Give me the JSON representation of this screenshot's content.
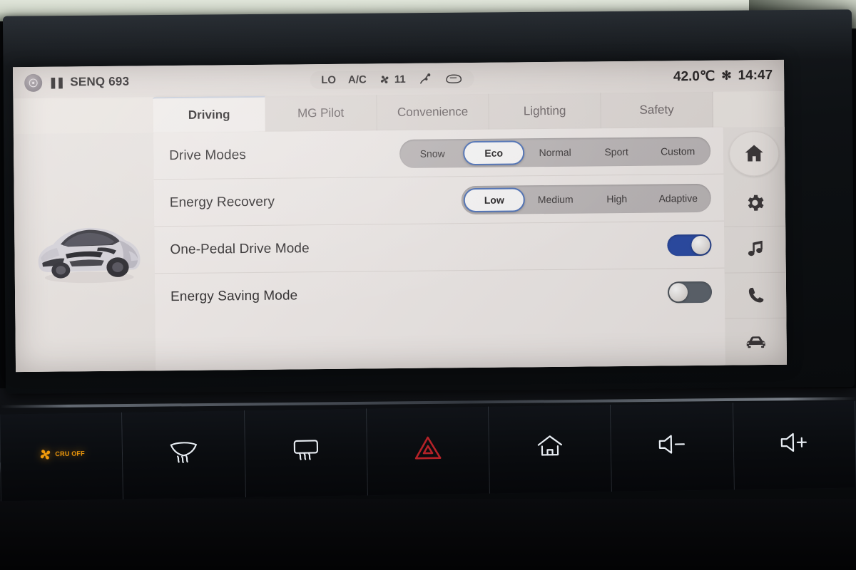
{
  "status_bar": {
    "media_icon": "media-source-icon",
    "playback_glyph": "❚❚",
    "track_title": "SENQ 693",
    "climate": {
      "temp_mode": "LO",
      "ac": "A/C",
      "fan_icon": "fan-icon",
      "fan_speed": "11",
      "airflow_icon": "airflow-direction-icon",
      "defrost_icon": "rear-defrost-icon"
    },
    "outside_temp": "42.0℃",
    "bluetooth_glyph": "✻",
    "clock": "14:47"
  },
  "tabs": [
    {
      "label": "Driving",
      "active": true
    },
    {
      "label": "MG Pilot",
      "active": false
    },
    {
      "label": "Convenience",
      "active": false
    },
    {
      "label": "Lighting",
      "active": false
    },
    {
      "label": "Safety",
      "active": false
    }
  ],
  "vehicle_image": {
    "alt": "MG electric hatchback front three-quarter view",
    "body_color": "#d9d6dc"
  },
  "settings": [
    {
      "label": "Drive Modes",
      "type": "segmented",
      "options": [
        "Snow",
        "Eco",
        "Normal",
        "Sport",
        "Custom"
      ],
      "selected": "Eco"
    },
    {
      "label": "Energy Recovery",
      "type": "segmented",
      "options": [
        "Low",
        "Medium",
        "High",
        "Adaptive"
      ],
      "selected": "Low"
    },
    {
      "label": "One-Pedal Drive Mode",
      "type": "toggle",
      "value": "on"
    },
    {
      "label": "Energy Saving Mode",
      "type": "toggle",
      "value": "off"
    }
  ],
  "dock": [
    {
      "name": "home",
      "icon": "home-icon"
    },
    {
      "name": "settings",
      "icon": "gear-icon"
    },
    {
      "name": "media",
      "icon": "music-note-icon"
    },
    {
      "name": "phone",
      "icon": "phone-icon"
    },
    {
      "name": "vehicle",
      "icon": "car-icon"
    }
  ],
  "hard_buttons": [
    {
      "name": "ac-off",
      "icon": "fan-off-icon",
      "label": "CRU OFF",
      "lit": "amber"
    },
    {
      "name": "front-defrost",
      "icon": "front-defrost-icon",
      "label": "",
      "lit": "white"
    },
    {
      "name": "rear-defrost",
      "icon": "rear-defrost-icon",
      "label": "",
      "lit": "white"
    },
    {
      "name": "hazard-lights",
      "icon": "hazard-triangle-icon",
      "label": "",
      "lit": "red"
    },
    {
      "name": "home",
      "icon": "home-outline-icon",
      "label": "",
      "lit": "white"
    },
    {
      "name": "volume-down",
      "icon": "volume-minus-icon",
      "label": "",
      "lit": "white"
    },
    {
      "name": "volume-up",
      "icon": "volume-plus-icon",
      "label": "",
      "lit": "white"
    }
  ],
  "colors": {
    "screen_bg": "#e8e3e0",
    "accent_blue": "#2a4ba6",
    "selected_border": "#4a6fb8",
    "segment_track": "#bcb7b8",
    "amber": "#f09a0c",
    "hazard_red": "#b52228"
  }
}
